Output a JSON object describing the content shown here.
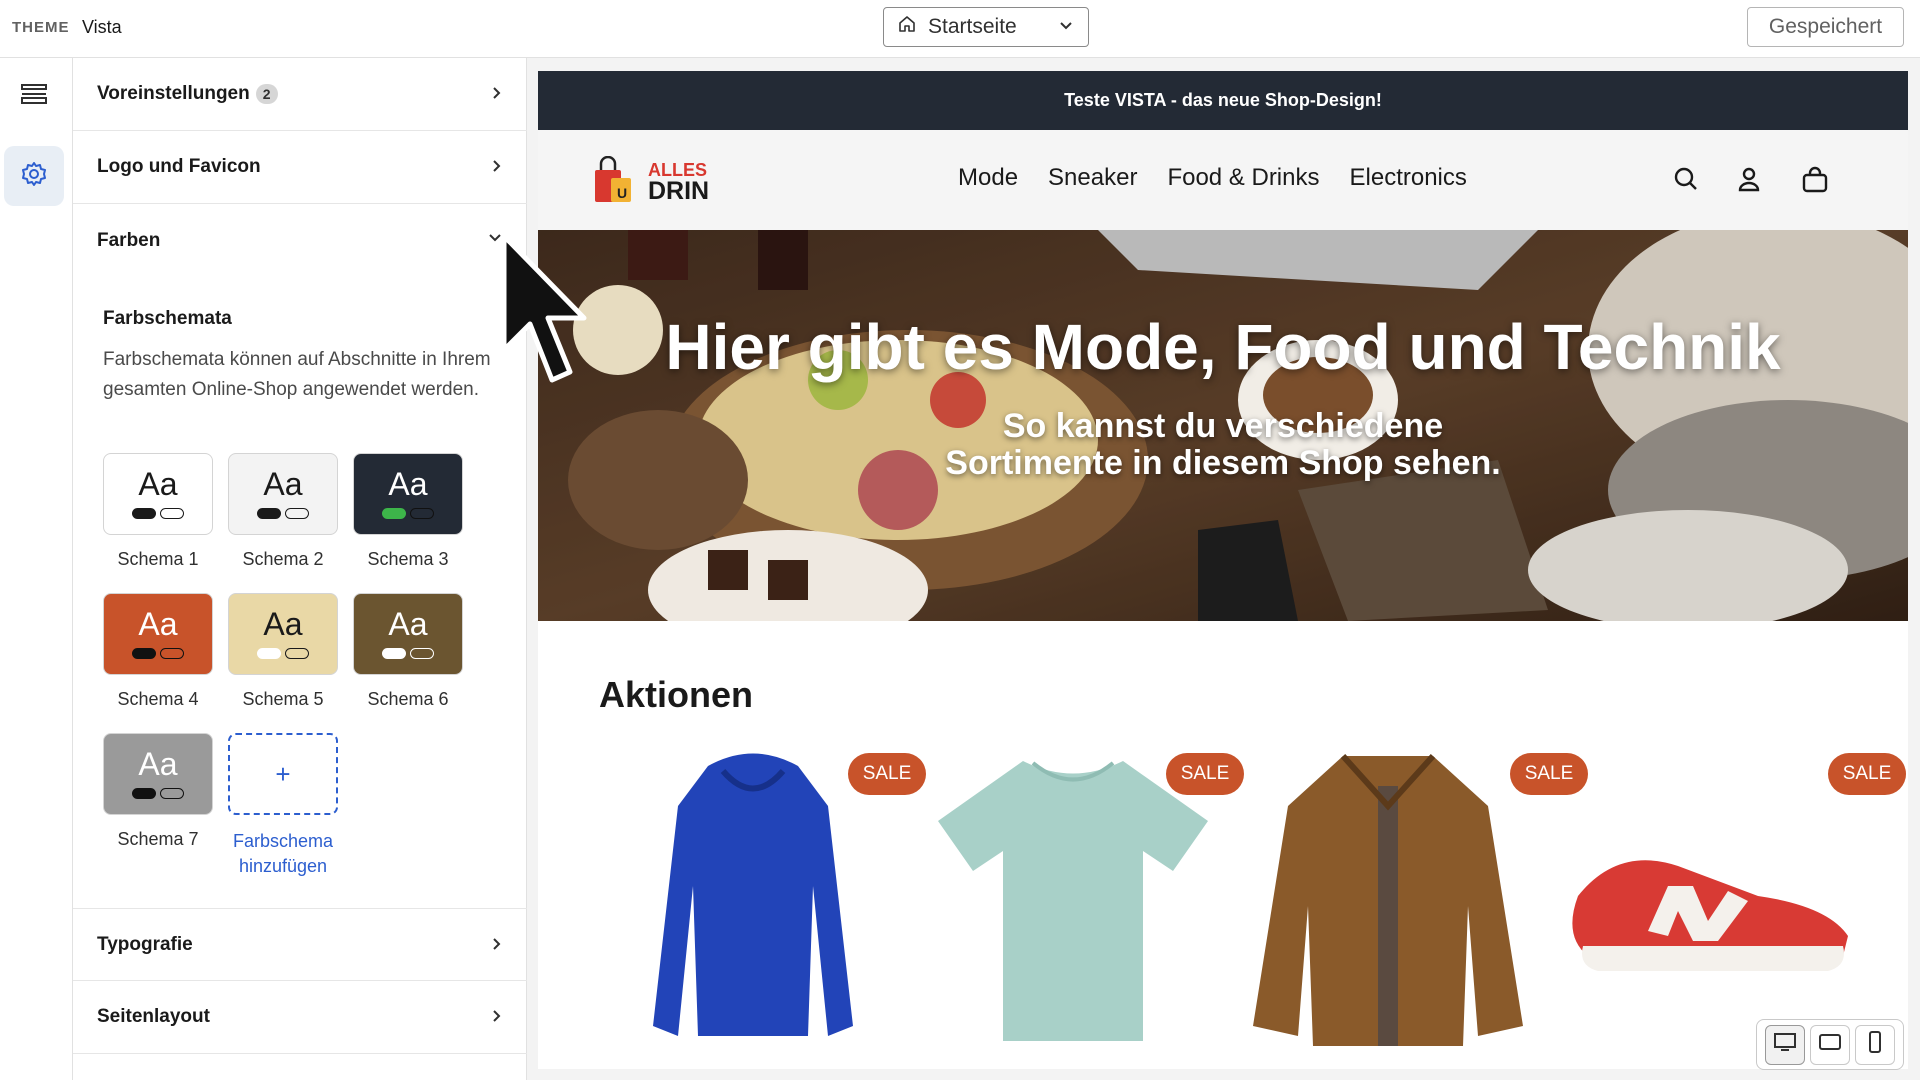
{
  "topbar": {
    "theme_label": "THEME",
    "theme_name": "Vista",
    "page_select_value": "Startseite",
    "saved_label": "Gespeichert"
  },
  "rail": {
    "items": [
      {
        "icon": "sections-icon",
        "active": false
      },
      {
        "icon": "gear-icon",
        "active": true
      }
    ]
  },
  "panel": {
    "sections": [
      {
        "label": "Voreinstellungen",
        "badge": "2",
        "expanded": false
      },
      {
        "label": "Logo und Favicon",
        "expanded": false
      },
      {
        "label": "Farben",
        "expanded": true
      },
      {
        "label": "Typografie",
        "expanded": false
      },
      {
        "label": "Seitenlayout",
        "expanded": false
      }
    ],
    "farbschemata": {
      "title": "Farbschemata",
      "description": "Farbschemata können auf Abschnitte in Ihrem gesamten Online-Shop angewendet werden.",
      "sample_text": "Aa",
      "schemes": [
        {
          "label": "Schema 1",
          "bg": "#ffffff",
          "fg": "#1a1a1a",
          "pill": "#1a1a1a",
          "outline": "#1a1a1a"
        },
        {
          "label": "Schema 2",
          "bg": "#f3f3f3",
          "fg": "#1a1a1a",
          "pill": "#1a1a1a",
          "outline": "#1a1a1a"
        },
        {
          "label": "Schema 3",
          "bg": "#232a35",
          "fg": "#ffffff",
          "pill": "#3db54a",
          "outline": "#111111"
        },
        {
          "label": "Schema 4",
          "bg": "#c8532a",
          "fg": "#ffffff",
          "pill": "#111111",
          "outline": "#111111"
        },
        {
          "label": "Schema 5",
          "bg": "#e9d8a6",
          "fg": "#1a1a1a",
          "pill": "#ffffff",
          "outline": "#1a1a1a"
        },
        {
          "label": "Schema 6",
          "bg": "#6b5530",
          "fg": "#ffffff",
          "pill": "#ffffff",
          "outline": "#ffffff"
        },
        {
          "label": "Schema 7",
          "bg": "#9a9a9a",
          "fg": "#ffffff",
          "pill": "#111111",
          "outline": "#111111"
        }
      ],
      "add_label": "Farbschema hinzufügen"
    }
  },
  "preview": {
    "announcement": "Teste VISTA - das neue Shop-Design!",
    "logo_line1": "ALLES",
    "logo_line2": "DRIN",
    "nav": [
      "Mode",
      "Sneaker",
      "Food & Drinks",
      "Electronics"
    ],
    "hero_title": "Hier gibt es Mode, Food und Technik",
    "hero_subtitle_line1": "So kannst du verschiedene",
    "hero_subtitle_line2": "Sortimente in diesem Shop sehen.",
    "section_title": "Aktionen",
    "sale_label": "SALE",
    "products": [
      {
        "name": "hoodie",
        "color": "#2244b8"
      },
      {
        "name": "t-shirt",
        "color": "#a8d0c8"
      },
      {
        "name": "jacket",
        "color": "#8a5a2a"
      },
      {
        "name": "sneaker",
        "color": "#d83a34"
      }
    ]
  },
  "device_toolbar": {
    "active": "desktop"
  }
}
